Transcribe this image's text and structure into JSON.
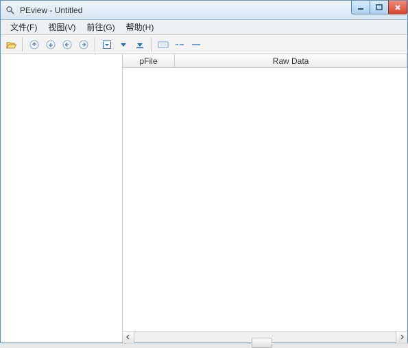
{
  "window": {
    "title": "PEview - Untitled"
  },
  "menubar": {
    "file": "文件(F)",
    "view": "视图(V)",
    "go": "前往(G)",
    "help": "帮助(H)"
  },
  "columns": {
    "pfile": "pFile",
    "rawdata": "Raw Data"
  },
  "icons": {
    "app": "magnifier-icon",
    "open": "folder-open-icon",
    "first": "arrow-first-icon",
    "prev": "arrow-prev-icon",
    "back": "arrow-back-icon",
    "forward": "arrow-forward-icon",
    "down1": "arrow-down-box-icon",
    "down2": "arrow-down-icon",
    "down3": "arrow-down-icon",
    "view1": "view-rect-icon",
    "view2": "view-dash-icon",
    "view3": "view-bar-icon"
  }
}
